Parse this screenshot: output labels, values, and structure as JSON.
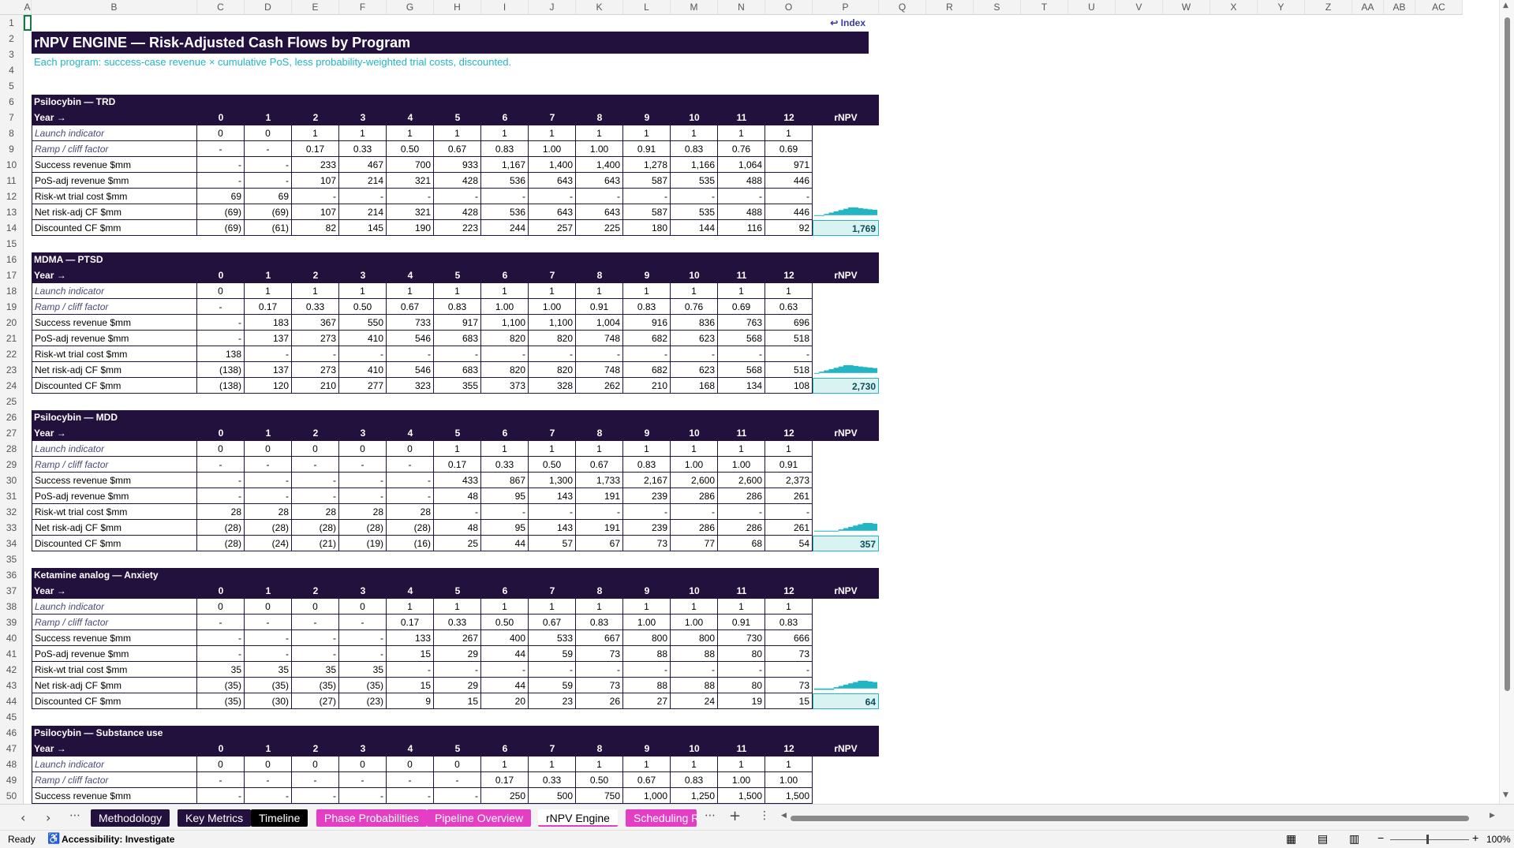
{
  "columns": [
    "A",
    "B",
    "C",
    "D",
    "E",
    "F",
    "G",
    "H",
    "I",
    "J",
    "K",
    "L",
    "M",
    "N",
    "O",
    "P",
    "Q",
    "R",
    "S",
    "T",
    "U",
    "V",
    "W",
    "X",
    "Y",
    "Z",
    "AA",
    "AB",
    "AC"
  ],
  "rows": [
    "1",
    "2",
    "3",
    "4",
    "5",
    "6",
    "7",
    "8",
    "9",
    "10",
    "11",
    "12",
    "13",
    "14",
    "15",
    "16",
    "17",
    "18",
    "19",
    "20",
    "21",
    "22",
    "23",
    "24",
    "25",
    "26",
    "27",
    "28",
    "29",
    "30",
    "31",
    "32",
    "33",
    "34",
    "35",
    "36",
    "37",
    "38",
    "39",
    "40",
    "41",
    "42",
    "43",
    "44",
    "45",
    "46",
    "47",
    "48",
    "49",
    "50"
  ],
  "index_link": "↩ Index",
  "title": "rNPV ENGINE — Risk-Adjusted Cash Flows by Program",
  "subtitle": "Each program: success-case revenue × cumulative PoS, less probability-weighted trial costs, discounted.",
  "year_label": "Year →",
  "years": [
    "0",
    "1",
    "2",
    "3",
    "4",
    "5",
    "6",
    "7",
    "8",
    "9",
    "10",
    "11",
    "12"
  ],
  "rnpv_label": "rNPV",
  "row_labels": [
    "Launch indicator",
    "Ramp / cliff factor",
    "Success revenue $mm",
    "PoS-adj revenue $mm",
    "Risk-wt trial cost $mm",
    "Net risk-adj CF $mm",
    "Discounted CF $mm"
  ],
  "programs": [
    {
      "name": "Psilocybin — TRD",
      "rnpv": "1,769",
      "spark": [
        -69,
        -69,
        107,
        214,
        321,
        428,
        536,
        643,
        643,
        587,
        535,
        488,
        446
      ],
      "rows": [
        [
          "0",
          "0",
          "1",
          "1",
          "1",
          "1",
          "1",
          "1",
          "1",
          "1",
          "1",
          "1",
          "1"
        ],
        [
          "-",
          "-",
          "0.17",
          "0.33",
          "0.50",
          "0.67",
          "0.83",
          "1.00",
          "1.00",
          "0.91",
          "0.83",
          "0.76",
          "0.69"
        ],
        [
          "-",
          "-",
          "233",
          "467",
          "700",
          "933",
          "1,167",
          "1,400",
          "1,400",
          "1,278",
          "1,166",
          "1,064",
          "971"
        ],
        [
          "-",
          "-",
          "107",
          "214",
          "321",
          "428",
          "536",
          "643",
          "643",
          "587",
          "535",
          "488",
          "446"
        ],
        [
          "69",
          "69",
          "-",
          "-",
          "-",
          "-",
          "-",
          "-",
          "-",
          "-",
          "-",
          "-",
          "-"
        ],
        [
          "(69)",
          "(69)",
          "107",
          "214",
          "321",
          "428",
          "536",
          "643",
          "643",
          "587",
          "535",
          "488",
          "446"
        ],
        [
          "(69)",
          "(61)",
          "82",
          "145",
          "190",
          "223",
          "244",
          "257",
          "225",
          "180",
          "144",
          "116",
          "92"
        ]
      ]
    },
    {
      "name": "MDMA — PTSD",
      "rnpv": "2,730",
      "spark": [
        -138,
        137,
        273,
        410,
        546,
        683,
        820,
        820,
        748,
        682,
        623,
        568,
        518
      ],
      "rows": [
        [
          "0",
          "1",
          "1",
          "1",
          "1",
          "1",
          "1",
          "1",
          "1",
          "1",
          "1",
          "1",
          "1"
        ],
        [
          "-",
          "0.17",
          "0.33",
          "0.50",
          "0.67",
          "0.83",
          "1.00",
          "1.00",
          "0.91",
          "0.83",
          "0.76",
          "0.69",
          "0.63"
        ],
        [
          "-",
          "183",
          "367",
          "550",
          "733",
          "917",
          "1,100",
          "1,100",
          "1,004",
          "916",
          "836",
          "763",
          "696"
        ],
        [
          "-",
          "137",
          "273",
          "410",
          "546",
          "683",
          "820",
          "820",
          "748",
          "682",
          "623",
          "568",
          "518"
        ],
        [
          "138",
          "-",
          "-",
          "-",
          "-",
          "-",
          "-",
          "-",
          "-",
          "-",
          "-",
          "-",
          "-"
        ],
        [
          "(138)",
          "137",
          "273",
          "410",
          "546",
          "683",
          "820",
          "820",
          "748",
          "682",
          "623",
          "568",
          "518"
        ],
        [
          "(138)",
          "120",
          "210",
          "277",
          "323",
          "355",
          "373",
          "328",
          "262",
          "210",
          "168",
          "134",
          "108"
        ]
      ]
    },
    {
      "name": "Psilocybin — MDD",
      "rnpv": "357",
      "spark": [
        -28,
        -28,
        -28,
        -28,
        -28,
        48,
        95,
        143,
        191,
        239,
        286,
        286,
        261
      ],
      "rows": [
        [
          "0",
          "0",
          "0",
          "0",
          "0",
          "1",
          "1",
          "1",
          "1",
          "1",
          "1",
          "1",
          "1"
        ],
        [
          "-",
          "-",
          "-",
          "-",
          "-",
          "0.17",
          "0.33",
          "0.50",
          "0.67",
          "0.83",
          "1.00",
          "1.00",
          "0.91"
        ],
        [
          "-",
          "-",
          "-",
          "-",
          "-",
          "433",
          "867",
          "1,300",
          "1,733",
          "2,167",
          "2,600",
          "2,600",
          "2,373"
        ],
        [
          "-",
          "-",
          "-",
          "-",
          "-",
          "48",
          "95",
          "143",
          "191",
          "239",
          "286",
          "286",
          "261"
        ],
        [
          "28",
          "28",
          "28",
          "28",
          "28",
          "-",
          "-",
          "-",
          "-",
          "-",
          "-",
          "-",
          "-"
        ],
        [
          "(28)",
          "(28)",
          "(28)",
          "(28)",
          "(28)",
          "48",
          "95",
          "143",
          "191",
          "239",
          "286",
          "286",
          "261"
        ],
        [
          "(28)",
          "(24)",
          "(21)",
          "(19)",
          "(16)",
          "25",
          "44",
          "57",
          "67",
          "73",
          "77",
          "68",
          "54"
        ]
      ]
    },
    {
      "name": "Ketamine analog — Anxiety",
      "rnpv": "64",
      "spark": [
        -35,
        -35,
        -35,
        -35,
        15,
        29,
        44,
        59,
        73,
        88,
        88,
        80,
        73
      ],
      "rows": [
        [
          "0",
          "0",
          "0",
          "0",
          "1",
          "1",
          "1",
          "1",
          "1",
          "1",
          "1",
          "1",
          "1"
        ],
        [
          "-",
          "-",
          "-",
          "-",
          "0.17",
          "0.33",
          "0.50",
          "0.67",
          "0.83",
          "1.00",
          "1.00",
          "0.91",
          "0.83"
        ],
        [
          "-",
          "-",
          "-",
          "-",
          "133",
          "267",
          "400",
          "533",
          "667",
          "800",
          "800",
          "730",
          "666"
        ],
        [
          "-",
          "-",
          "-",
          "-",
          "15",
          "29",
          "44",
          "59",
          "73",
          "88",
          "88",
          "80",
          "73"
        ],
        [
          "35",
          "35",
          "35",
          "35",
          "-",
          "-",
          "-",
          "-",
          "-",
          "-",
          "-",
          "-",
          "-"
        ],
        [
          "(35)",
          "(35)",
          "(35)",
          "(35)",
          "15",
          "29",
          "44",
          "59",
          "73",
          "88",
          "88",
          "80",
          "73"
        ],
        [
          "(35)",
          "(30)",
          "(27)",
          "(23)",
          "9",
          "15",
          "20",
          "23",
          "26",
          "27",
          "24",
          "19",
          "15"
        ]
      ]
    },
    {
      "name": "Psilocybin — Substance use",
      "rnpv": "",
      "spark": [],
      "rows": [
        [
          "0",
          "0",
          "0",
          "0",
          "0",
          "0",
          "1",
          "1",
          "1",
          "1",
          "1",
          "1",
          "1"
        ],
        [
          "-",
          "-",
          "-",
          "-",
          "-",
          "-",
          "0.17",
          "0.33",
          "0.50",
          "0.67",
          "0.83",
          "1.00",
          "1.00"
        ],
        [
          "-",
          "-",
          "-",
          "-",
          "-",
          "-",
          "250",
          "500",
          "750",
          "1,000",
          "1,250",
          "1,500",
          "1,500"
        ]
      ]
    }
  ],
  "tabs": [
    {
      "label": "Methodology",
      "bg": "#22113d",
      "fg": "#ffffff"
    },
    {
      "label": "Key Metrics",
      "bg": "#22113d",
      "fg": "#ffffff"
    },
    {
      "label": "Timeline",
      "bg": "#000000",
      "fg": "#ffffff"
    },
    {
      "label": "Phase Probabilities",
      "bg": "#e43fc4",
      "fg": "#ffffff"
    },
    {
      "label": "Pipeline Overview",
      "bg": "#e43fc4",
      "fg": "#ffffff"
    },
    {
      "label": "rNPV Engine",
      "bg": "#ffffff",
      "fg": "#000000"
    },
    {
      "label": "Scheduling R",
      "bg": "#e43fc4",
      "fg": "#ffffff"
    }
  ],
  "status": {
    "ready": "Ready",
    "accessibility": "Accessibility: Investigate",
    "zoom": "100%"
  },
  "colors": {
    "navy": "#22113d",
    "teal": "#22b5c4",
    "accent_text": "#22b5c4",
    "magenta": "#e43fc4"
  }
}
